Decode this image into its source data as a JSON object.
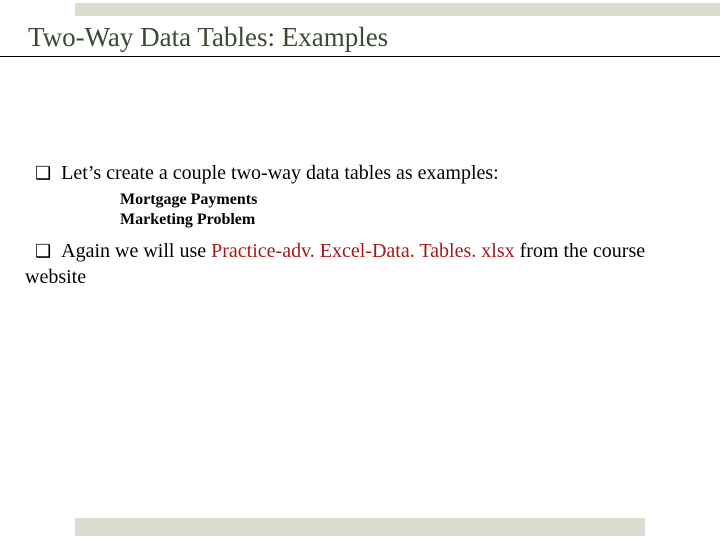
{
  "title": "Two-Way Data Tables: Examples",
  "bullets": {
    "b1": "Let’s create a couple two-way data tables as examples:",
    "sub1": "Mortgage Payments",
    "sub2": "Marketing Problem",
    "b2_pre": "Again we will use ",
    "b2_file": "Practice-adv. Excel-Data. Tables. xlsx",
    "b2_post": " from the course website"
  },
  "glyphs": {
    "checkbox": "❑"
  }
}
